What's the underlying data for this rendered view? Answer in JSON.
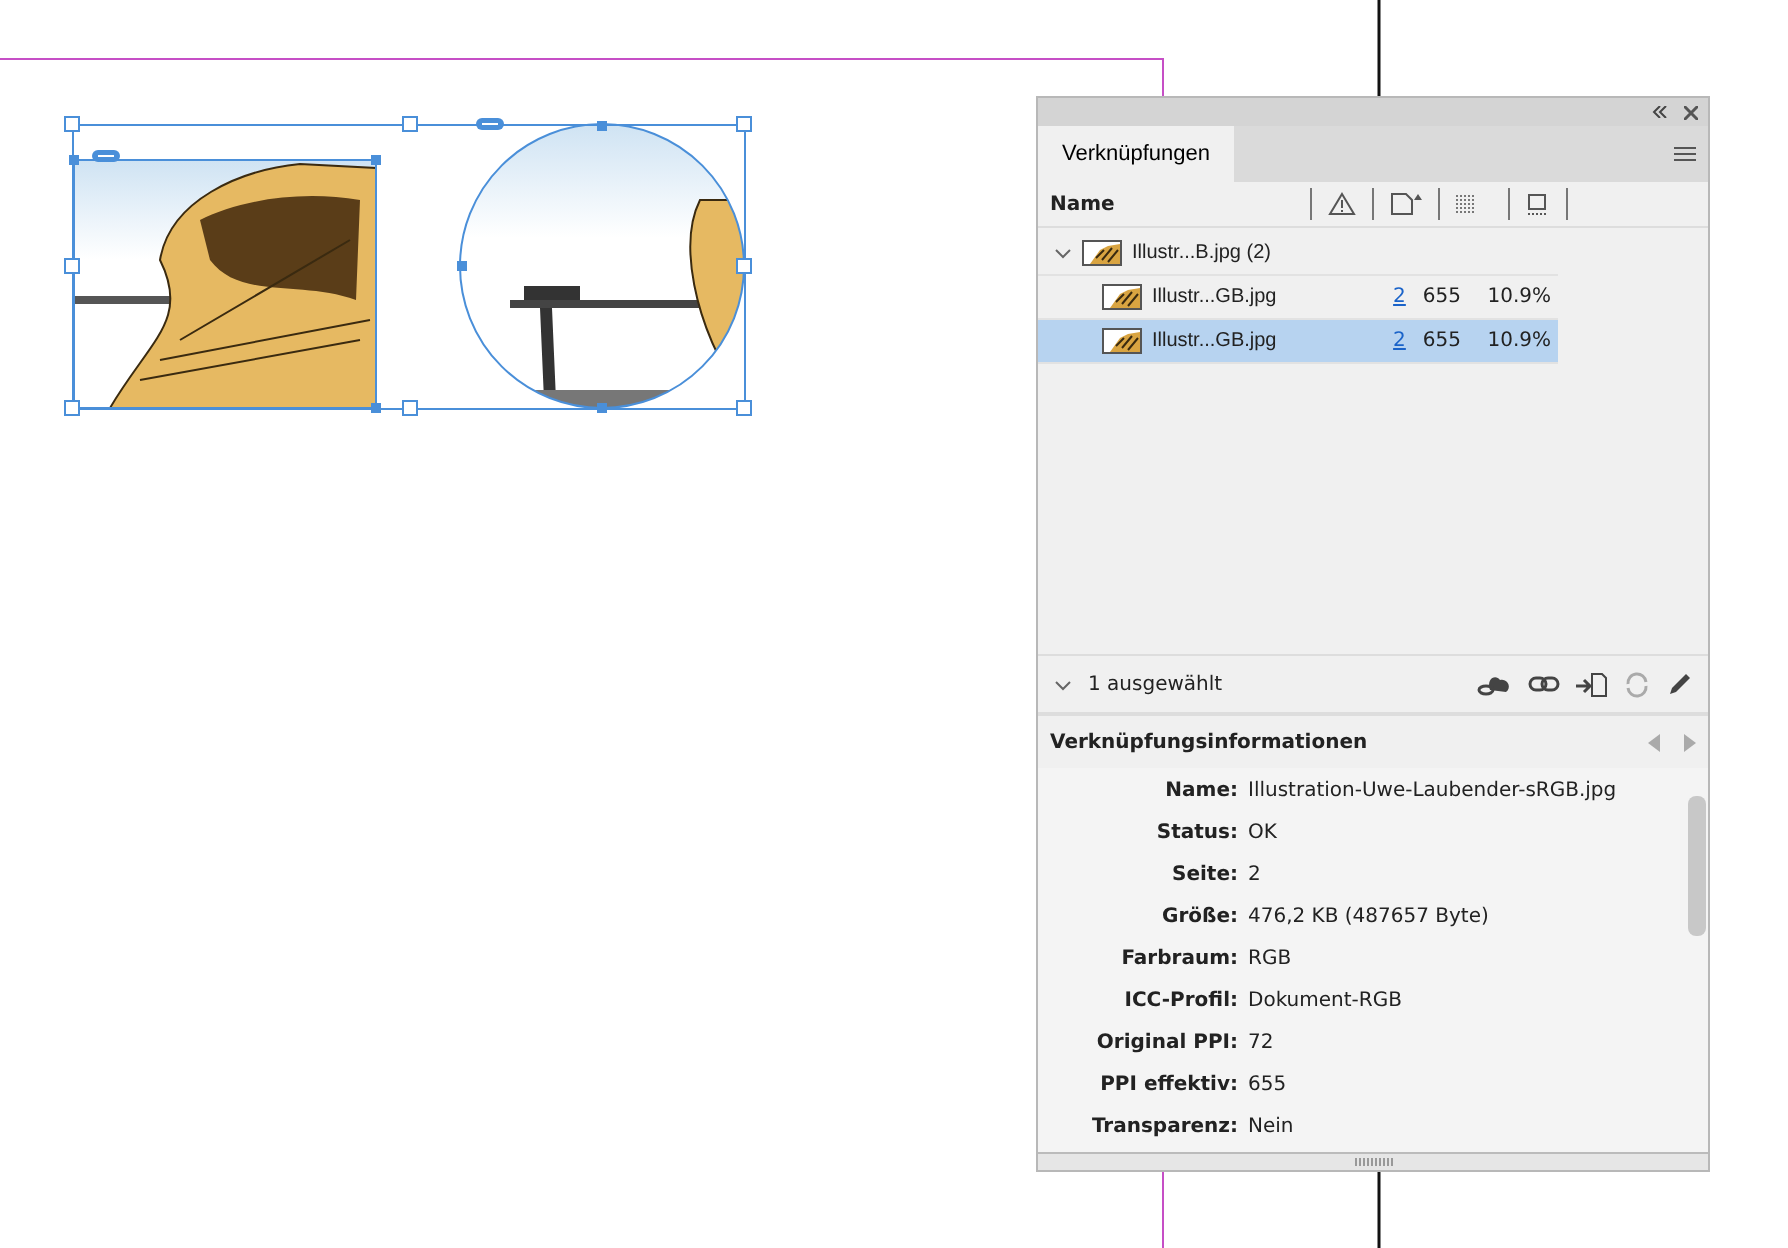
{
  "panel": {
    "tabs": [
      {
        "label": "Verknüpfungen",
        "selected": true
      }
    ],
    "columns": [
      {
        "label": "Name"
      }
    ],
    "links": [
      {
        "name": "Illustr...B.jpg (2)",
        "expanded": true,
        "selected": false,
        "children": [
          {
            "name": "Illustr...GB.jpg",
            "page": "2",
            "ppi": "655",
            "scale": "10.9%",
            "selected": false
          },
          {
            "name": "Illustr...GB.jpg",
            "page": "2",
            "ppi": "655",
            "scale": "10.9%",
            "selected": true
          }
        ]
      }
    ],
    "selection_status": "1 ausgewählt",
    "info_title": "Verknüpfungsinformationen",
    "info": [
      {
        "label": "Name:",
        "value": "Illustration-Uwe-Laubender-sRGB.jpg"
      },
      {
        "label": "Status:",
        "value": "OK"
      },
      {
        "label": "Seite:",
        "value": "2"
      },
      {
        "label": "Größe:",
        "value": "476,2 KB (487657 Byte)"
      },
      {
        "label": "Farbraum:",
        "value": "RGB"
      },
      {
        "label": "ICC-Profil:",
        "value": "Dokument-RGB"
      },
      {
        "label": "Original PPI:",
        "value": "72"
      },
      {
        "label": "PPI effektiv:",
        "value": "655"
      },
      {
        "label": "Transparenz:",
        "value": "Nein"
      }
    ]
  }
}
